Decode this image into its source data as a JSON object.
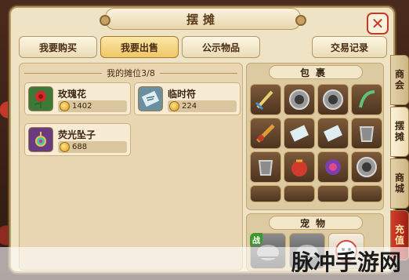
{
  "window": {
    "title": "摆摊",
    "close_label": "✕"
  },
  "tabs": [
    {
      "label": "我要购买",
      "active": false
    },
    {
      "label": "我要出售",
      "active": true
    },
    {
      "label": "公示物品",
      "active": false
    },
    {
      "label": "交易记录",
      "active": false
    }
  ],
  "stall": {
    "header": "我的摊位3/8",
    "items": [
      {
        "name": "玫瑰花",
        "price": "1402",
        "icon": "rose-icon"
      },
      {
        "name": "临时符",
        "price": "224",
        "icon": "talisman-icon"
      },
      {
        "name": "荧光坠子",
        "price": "688",
        "icon": "pendant-icon"
      }
    ]
  },
  "bag": {
    "header": "包裹",
    "slots": [
      "sword-icon",
      "bowl-icon",
      "bowl-icon",
      "jade-hook-icon",
      "fan-icon",
      "scroll-icon",
      "scroll-icon",
      "armor-icon",
      "armor-icon",
      "red-bag-icon",
      "gem-icon",
      "bowl-icon",
      "sword-icon",
      "helmet-icon",
      "sword-icon",
      "belt-icon"
    ]
  },
  "pets": {
    "header": "宠物",
    "battle_tag": "战",
    "slots": [
      "beast-icon",
      "beast-icon",
      "ghost-pet-icon"
    ]
  },
  "side_tabs": [
    {
      "label": "商会",
      "active": false
    },
    {
      "label": "摆摊",
      "active": true
    },
    {
      "label": "商城",
      "active": false
    },
    {
      "label": "充值",
      "active": false
    }
  ],
  "watermark": {
    "text": "脉冲手游网"
  },
  "colors": {
    "panel_bg": "#efe3c6",
    "active_tab": "#efc767",
    "close_red": "#c23a2a",
    "coin_gold": "#d59a1a"
  }
}
